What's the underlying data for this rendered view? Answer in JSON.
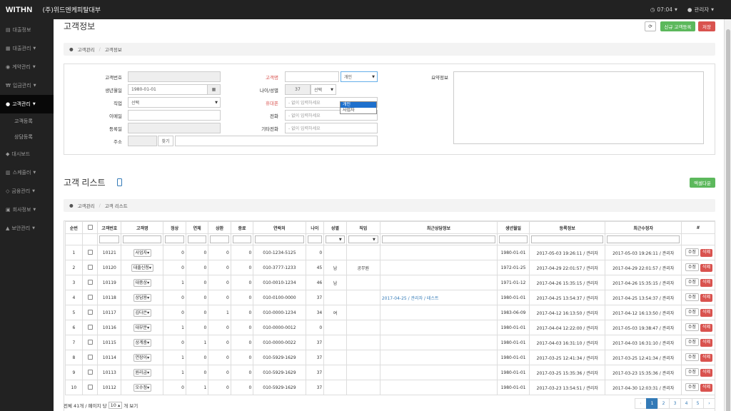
{
  "topbar": {
    "brand": "WITHN",
    "company": "(주)위드엔케피탈대부",
    "time": "07:04",
    "user": "관리자"
  },
  "sidebar": {
    "items": [
      {
        "icon": "▤",
        "label": "대출정보"
      },
      {
        "icon": "▦",
        "label": "대출관리"
      },
      {
        "icon": "◉",
        "label": "계약관리"
      },
      {
        "icon": "₩",
        "label": "입금관리"
      },
      {
        "icon": "●",
        "label": "고객관리"
      }
    ],
    "subs": [
      "고객등록",
      "상담등록"
    ],
    "items2": [
      {
        "icon": "◆",
        "label": "대시보드"
      },
      {
        "icon": "▥",
        "label": "스케줄러"
      },
      {
        "icon": "◇",
        "label": "금융관리"
      },
      {
        "icon": "▣",
        "label": "회사정보"
      },
      {
        "icon": "▲",
        "label": "보안관리"
      }
    ]
  },
  "page": {
    "title": "고객정보",
    "buttons": {
      "refresh": "⟳",
      "new": "신규 고객등록",
      "save": "저장"
    },
    "breadcrumb1": {
      "home": "고객관리",
      "current": "고객정보"
    },
    "breadcrumb2": {
      "home": "고객관리",
      "current": "고객 리스트"
    },
    "list_title": "고객 리스트",
    "excel": "엑셀다운"
  },
  "form": {
    "labels": {
      "cust_no": "고객번호",
      "birth": "생년월일",
      "job": "직업",
      "email": "이메일",
      "reg_date": "등록일",
      "address": "주소",
      "name": "고객명",
      "age_gender": "나이/성별",
      "mobile": "휴대폰",
      "phone": "전화",
      "other_phone": "기타전화",
      "summary": "요약정보"
    },
    "birth_value": "1980-01-01",
    "job_value": "선택",
    "age_value": "37",
    "gender_value": "선택",
    "type_value": "개인",
    "type_options": [
      "개인",
      "사업자"
    ],
    "placeholder_phone": "- 없이 입력하세요",
    "find_button": "찾기"
  },
  "table": {
    "headers": [
      "순번",
      "",
      "고객번호",
      "고객명",
      "정상",
      "연체",
      "상환",
      "종료",
      "연락처",
      "나이",
      "성별",
      "직업",
      "최근상담정보",
      "생년월일",
      "등록정보",
      "최근수정자",
      "#"
    ],
    "edit_label": "수정",
    "delete_label": "삭제",
    "rows": [
      {
        "seq": "1",
        "no": "10121",
        "name": "사업자",
        "n1": "0",
        "n2": "0",
        "n3": "0",
        "n4": "0",
        "tel": "010-1234-5125",
        "age": "0",
        "gender": "",
        "job": "",
        "consult": "",
        "birth": "1980-01-01",
        "reg": "2017-05-03 19:26:11 / 관리자",
        "mod": "2017-05-03 19:26:11 / 관리자"
      },
      {
        "seq": "2",
        "no": "10120",
        "name": "대출신청",
        "n1": "0",
        "n2": "0",
        "n3": "0",
        "n4": "0",
        "tel": "010-3777-1233",
        "age": "45",
        "gender": "남",
        "job": "공무원",
        "consult": "",
        "birth": "1972-01-25",
        "reg": "2017-04-29 22:01:57 / 관리자",
        "mod": "2017-04-29 22:01:57 / 관리자"
      },
      {
        "seq": "3",
        "no": "10119",
        "name": "대중상",
        "n1": "1",
        "n2": "0",
        "n3": "0",
        "n4": "0",
        "tel": "010-0010-1234",
        "age": "46",
        "gender": "남",
        "job": "",
        "consult": "",
        "birth": "1971-01-12",
        "reg": "2017-04-26 15:35:15 / 관리자",
        "mod": "2017-04-26 15:35:15 / 관리자"
      },
      {
        "seq": "4",
        "no": "10118",
        "name": "상담용",
        "n1": "0",
        "n2": "0",
        "n3": "0",
        "n4": "0",
        "tel": "010-0100-0000",
        "age": "37",
        "gender": "",
        "job": "",
        "consult": "2017-04-25 / 관리자 / 테스트",
        "birth": "1980-01-01",
        "reg": "2017-04-25 13:54:37 / 관리자",
        "mod": "2017-04-25 13:54:37 / 관리자"
      },
      {
        "seq": "5",
        "no": "10117",
        "name": "김다은",
        "n1": "0",
        "n2": "0",
        "n3": "1",
        "n4": "0",
        "tel": "010-0000-1234",
        "age": "34",
        "gender": "여",
        "job": "",
        "consult": "",
        "birth": "1983-06-09",
        "reg": "2017-04-12 16:13:50 / 관리자",
        "mod": "2017-04-12 16:13:50 / 관리자"
      },
      {
        "seq": "6",
        "no": "10116",
        "name": "대부분",
        "n1": "1",
        "n2": "0",
        "n3": "0",
        "n4": "0",
        "tel": "010-0000-0012",
        "age": "0",
        "gender": "",
        "job": "",
        "consult": "",
        "birth": "1980-01-01",
        "reg": "2017-04-04 12:22:00 / 관리자",
        "mod": "2017-05-03 19:38:47 / 관리자"
      },
      {
        "seq": "7",
        "no": "10115",
        "name": "상계충",
        "n1": "0",
        "n2": "1",
        "n3": "0",
        "n4": "0",
        "tel": "010-0000-0022",
        "age": "37",
        "gender": "",
        "job": "",
        "consult": "",
        "birth": "1980-01-01",
        "reg": "2017-04-03 16:31:10 / 관리자",
        "mod": "2017-04-03 16:31:10 / 관리자"
      },
      {
        "seq": "8",
        "no": "10114",
        "name": "연장이",
        "n1": "1",
        "n2": "0",
        "n3": "0",
        "n4": "0",
        "tel": "010-5929-1629",
        "age": "37",
        "gender": "",
        "job": "",
        "consult": "",
        "birth": "1980-01-01",
        "reg": "2017-03-25 12:41:34 / 관리자",
        "mod": "2017-03-25 12:41:34 / 관리자"
      },
      {
        "seq": "9",
        "no": "10113",
        "name": "원리금",
        "n1": "1",
        "n2": "0",
        "n3": "0",
        "n4": "0",
        "tel": "010-5929-1629",
        "age": "37",
        "gender": "",
        "job": "",
        "consult": "",
        "birth": "1980-01-01",
        "reg": "2017-03-25 15:35:36 / 관리자",
        "mod": "2017-03-23 15:35:36 / 관리자"
      },
      {
        "seq": "10",
        "no": "10112",
        "name": "오수정",
        "n1": "0",
        "n2": "1",
        "n3": "0",
        "n4": "0",
        "tel": "010-5929-1629",
        "age": "37",
        "gender": "",
        "job": "",
        "consult": "",
        "birth": "1980-01-01",
        "reg": "2017-03-23 13:54:51 / 관리자",
        "mod": "2017-04-30 12:03:31 / 관리자"
      }
    ]
  },
  "footer": {
    "total_prefix": "전체 41개 / 페이지 당",
    "per_page": "10",
    "total_suffix": "개 보기"
  },
  "pager": {
    "prev": "‹",
    "pages": [
      "1",
      "2",
      "3",
      "4",
      "5"
    ],
    "next": "›"
  }
}
